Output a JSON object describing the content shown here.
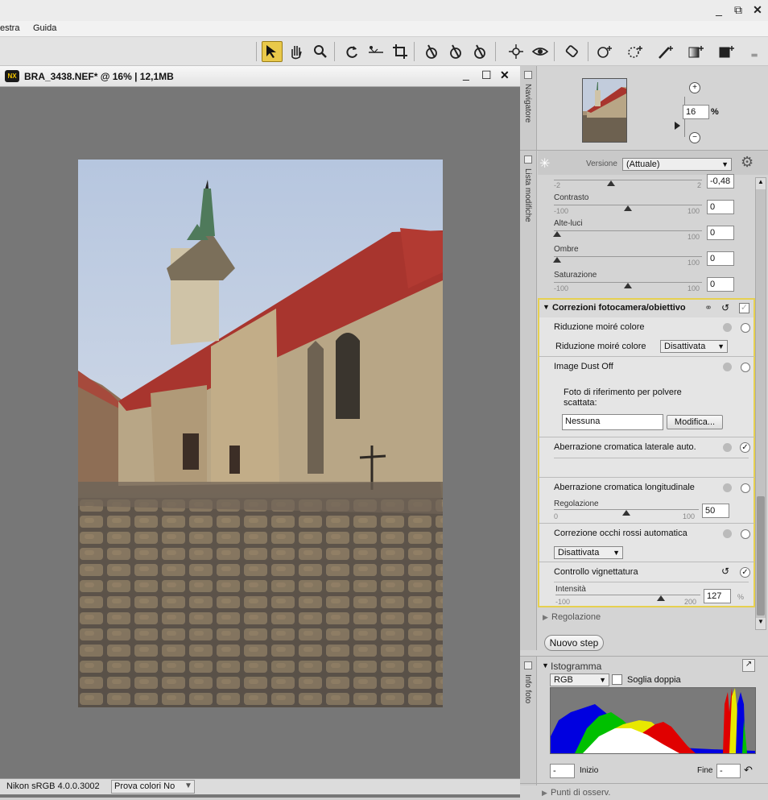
{
  "window": {
    "minimize": "_",
    "restore": "⧉",
    "close": "✕"
  },
  "menu": {
    "items": [
      "estra",
      "Guida"
    ]
  },
  "document": {
    "title": "BRA_3438.NEF* @ 16% | 12,1MB",
    "app_badge": "NX",
    "min": "_",
    "max": "☐",
    "close": "✕",
    "status_profile": "Nikon sRGB 4.0.0.3002",
    "softproof": "Prova colori No"
  },
  "navigator": {
    "tab": "Navigatore",
    "zoom_value": "16",
    "zoom_unit": "%"
  },
  "edit_list": {
    "tab": "Lista modifiche",
    "version_label": "Versione",
    "version_value": "(Attuale)",
    "partial_slider": {
      "min": "-2",
      "max": "2",
      "value": "-0,48"
    },
    "sliders": [
      {
        "label": "Contrasto",
        "min": "-100",
        "max": "100",
        "value": "0"
      },
      {
        "label": "Alte-luci",
        "min": "",
        "max": "100",
        "value": "0"
      },
      {
        "label": "Ombre",
        "min": "",
        "max": "100",
        "value": "0"
      },
      {
        "label": "Saturazione",
        "min": "-100",
        "max": "100",
        "value": "0"
      }
    ],
    "section_title": "Correzioni fotocamera/obiettivo",
    "moire": {
      "title": "Riduzione moiré colore",
      "label": "Riduzione moiré colore",
      "value": "Disattivata"
    },
    "dust": {
      "title": "Image Dust Off",
      "desc1": "Foto di riferimento per polvere",
      "desc2": "scattata:",
      "field": "Nessuna",
      "button": "Modifica..."
    },
    "lateral_ca": {
      "title": "Aberrazione cromatica laterale auto."
    },
    "longitudinal_ca": {
      "title": "Aberrazione cromatica longitudinale",
      "slider_label": "Regolazione",
      "min": "0",
      "max": "100",
      "value": "50"
    },
    "redeye": {
      "title": "Correzione occhi rossi automatica",
      "value": "Disattivata"
    },
    "vignette": {
      "title": "Controllo vignettatura",
      "slider_label": "Intensità",
      "min": "-100",
      "max": "200",
      "value": "127",
      "unit": "%"
    },
    "adjust_section": "Regolazione",
    "new_step": "Nuovo step"
  },
  "histogram": {
    "tab": "Info foto",
    "title": "Istogramma",
    "channel": "RGB",
    "double_threshold": "Soglia doppia",
    "start_label": "Inizio",
    "start_value": "-",
    "end_label": "Fine",
    "end_value": "-"
  },
  "observation_points": "Punti di osserv.",
  "colors": {
    "accent": "#e6d050",
    "active_tool": "#e9c94a",
    "canvas": "#777777"
  }
}
